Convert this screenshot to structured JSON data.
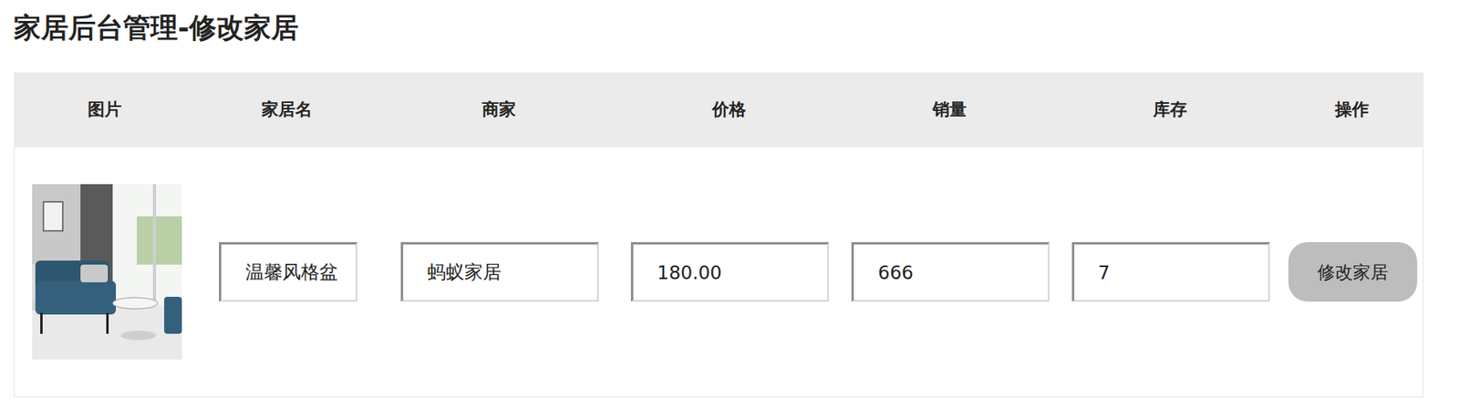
{
  "page": {
    "title": "家居后台管理-修改家居"
  },
  "table": {
    "columns": [
      "图片",
      "家居名",
      "商家",
      "价格",
      "销量",
      "库存",
      "操作"
    ],
    "rows": [
      {
        "name": "温馨风格盆",
        "merchant": "蚂蚁家居",
        "price": "180.00",
        "sales": "666",
        "stock": "7",
        "action": "修改家居"
      }
    ]
  }
}
